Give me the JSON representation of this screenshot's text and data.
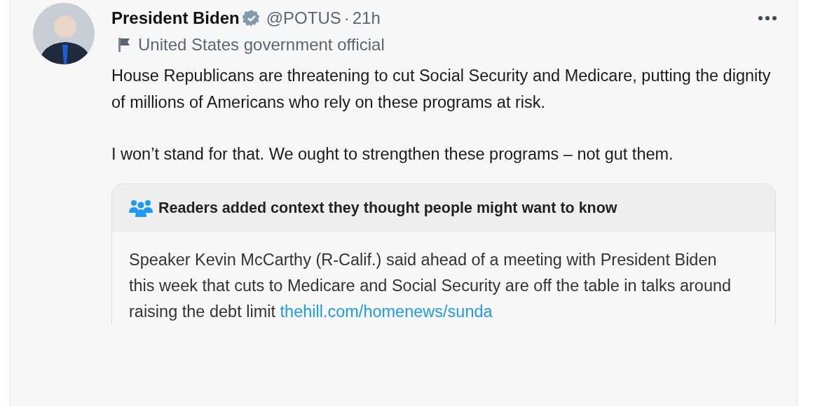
{
  "post": {
    "author": "President Biden",
    "handle": "@POTUS",
    "separator": "·",
    "time": "21h",
    "label": "United States government official",
    "paragraphs": [
      "House Republicans are threatening to cut Social Security and Medicare, putting the dignity of millions of Americans who rely on these programs at risk.",
      "I won’t stand for that. We ought to strengthen these programs – not gut them."
    ],
    "note": {
      "title": "Readers added context they thought people might want to know",
      "text": "Speaker Kevin McCarthy (R-Calif.) said ahead of a meeting with President Biden this week that cuts to Medicare and Social Security are off the table in talks around raising the debt limit",
      "link": "thehill.com/homenews/sunda"
    }
  }
}
